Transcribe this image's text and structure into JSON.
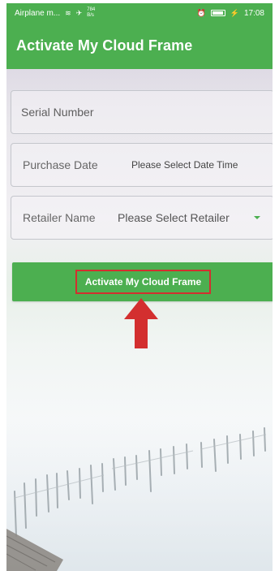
{
  "status_bar": {
    "carrier": "Airplane m...",
    "left_icons": [
      "wifi-icon",
      "airplane-icon"
    ],
    "data_speed_top": "784",
    "data_speed_bottom": "B/s",
    "right_icons": [
      "alarm-icon",
      "battery-icon",
      "charging-icon"
    ],
    "time": "17:08"
  },
  "app_bar": {
    "title": "Activate My Cloud Frame"
  },
  "form": {
    "serial_placeholder": "Serial Number",
    "purchase_date_label": "Purchase Date",
    "purchase_date_value": "Please Select Date Time",
    "retailer_label": "Retailer Name",
    "retailer_value": "Please Select Retailer"
  },
  "button": {
    "label": "Activate My Cloud Frame"
  },
  "colors": {
    "primary": "#4caf50",
    "highlight": "#d32f2f",
    "arrow": "#d32f2f"
  }
}
